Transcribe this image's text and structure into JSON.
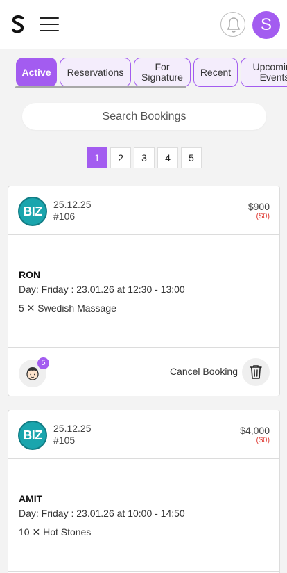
{
  "header": {
    "logo_icon": "s-logo-icon",
    "menu_icon": "hamburger-menu-icon",
    "notification_icon": "bell-icon",
    "user_initial": "S",
    "accent_color": "#a35cf0"
  },
  "tabs": [
    {
      "label": "Active",
      "active": true
    },
    {
      "label": "Reservations",
      "active": false
    },
    {
      "label": "For Signature",
      "active": false
    },
    {
      "label": "Recent",
      "active": false
    },
    {
      "label": "Upcoming Events",
      "active": false
    }
  ],
  "search": {
    "placeholder": "Search Bookings"
  },
  "pagination": {
    "pages": [
      "1",
      "2",
      "3",
      "4",
      "5"
    ],
    "current": "1"
  },
  "bookings": [
    {
      "badge": "BIZ",
      "date": "25.12.25",
      "number": "#106",
      "price": "$900",
      "price_sub": "($0)",
      "client": "RON",
      "day": "Day: Friday : 23.01.26 at 12:30 - 13:00",
      "service": "5 ✕ Swedish Massage",
      "participants": "5",
      "cancel_label": "Cancel Booking"
    },
    {
      "badge": "BIZ",
      "date": "25.12.25",
      "number": "#105",
      "price": "$4,000",
      "price_sub": "($0)",
      "client": "AMIT",
      "day": "Day: Friday : 23.01.26 at 10:00 - 14:50",
      "service": "10 ✕ Hot Stones"
    }
  ]
}
